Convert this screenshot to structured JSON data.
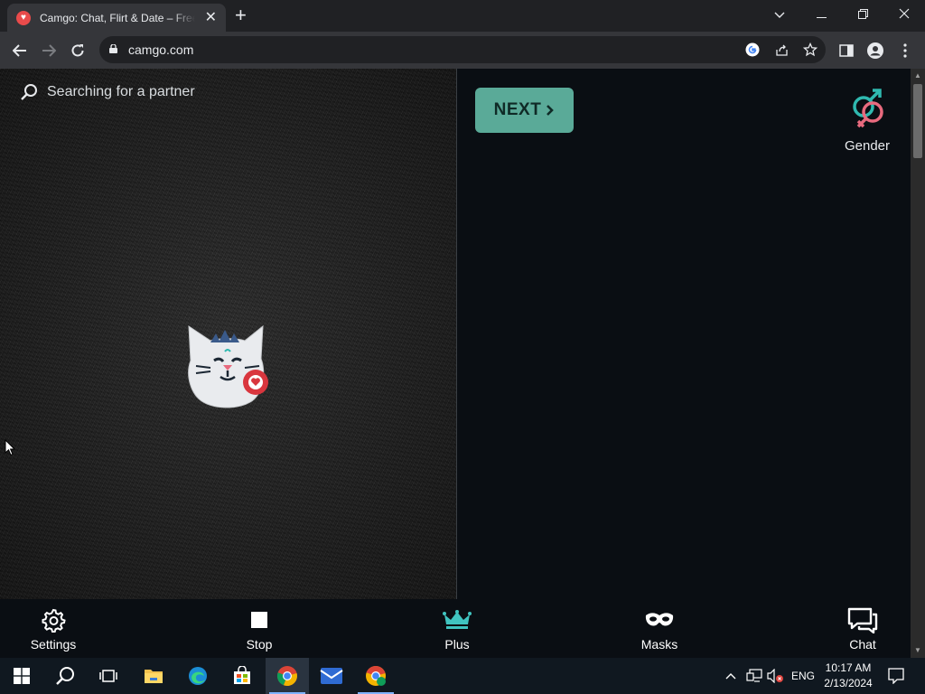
{
  "browser": {
    "tab_title": "Camgo: Chat, Flirt & Date – Free",
    "tab_close": "✕",
    "new_tab": "+",
    "url": "camgo.com",
    "window_controls": {
      "dropdown": "⌵",
      "minimize": "—",
      "restore": "❐",
      "close": "✕"
    }
  },
  "page": {
    "searching_text": "Searching for a partner",
    "next_label": "NEXT",
    "gender_label": "Gender",
    "bottom_nav": [
      {
        "label": "Settings",
        "icon": "gear-icon"
      },
      {
        "label": "Stop",
        "icon": "stop-icon"
      },
      {
        "label": "Plus",
        "icon": "crown-icon"
      },
      {
        "label": "Masks",
        "icon": "mask-icon"
      },
      {
        "label": "Chat",
        "icon": "chat-icon"
      }
    ],
    "colors": {
      "accent": "#5aaa98",
      "plus": "#40c4c0",
      "male": "#2fb9b0",
      "female": "#e86a7e"
    }
  },
  "taskbar": {
    "language": "ENG",
    "time": "10:17 AM",
    "date": "2/13/2024"
  }
}
